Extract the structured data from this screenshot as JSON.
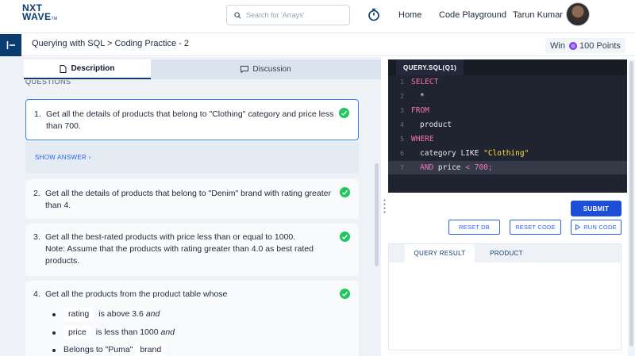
{
  "header": {
    "logo_line1": "NXT",
    "logo_line2": "WAVE",
    "logo_tm": "TM",
    "search_placeholder": "Search for 'Arrays'",
    "nav": {
      "home": "Home",
      "code_playground": "Code Playground",
      "user_name": "Tarun Kumar"
    }
  },
  "subheader": {
    "breadcrumb": "Querying with SQL > Coding Practice - 2",
    "win_label": "Win",
    "points": "100 Points"
  },
  "left_panel": {
    "tabs": {
      "description": "Description",
      "discussion": "Discussion"
    },
    "section_label": "QUESTIONS",
    "show_answer": "SHOW ANSWER ›",
    "questions": [
      {
        "num": "1.",
        "text": "Get all the details of products that belong to \"Clothing\" category and price less than 700."
      },
      {
        "num": "2.",
        "text": "Get all the details of products that belong to \"Denim\" brand with rating greater than 4."
      },
      {
        "num": "3.",
        "text": "Get all the best-rated products with price less than or equal to 1000.",
        "note": "Note: Assume that the products with rating greater than 4.0 as best rated products."
      },
      {
        "num": "4.",
        "text": "Get all the products from the product table whose"
      }
    ],
    "bullets": [
      {
        "chip": "rating",
        "rest": "is above 3.6",
        "em": "and"
      },
      {
        "chip": "price",
        "rest": "is less than 1000",
        "em": "and"
      },
      {
        "pre": "Belongs to \"Puma\"",
        "chip": "brand",
        "rest": ""
      }
    ]
  },
  "editor": {
    "tab": "QUERY.SQL(Q1)",
    "lines": [
      {
        "n": "1",
        "code": "SELECT"
      },
      {
        "n": "2",
        "code": "*"
      },
      {
        "n": "3",
        "code": "FROM"
      },
      {
        "n": "4",
        "code": "product"
      },
      {
        "n": "5",
        "code": "WHERE"
      },
      {
        "n": "6",
        "kw": "category LIKE",
        "str": "\"Clothing\""
      },
      {
        "n": "7",
        "kw": "AND",
        "code": "price",
        "op": "<",
        "num": "700;"
      }
    ]
  },
  "buttons": {
    "submit": "SUBMIT",
    "reset_db": "RESET DB",
    "reset_code": "RESET CODE",
    "run_code": "RUN CODE"
  },
  "result": {
    "tab_query": "QUERY RESULT",
    "tab_product": "PRODUCT"
  }
}
